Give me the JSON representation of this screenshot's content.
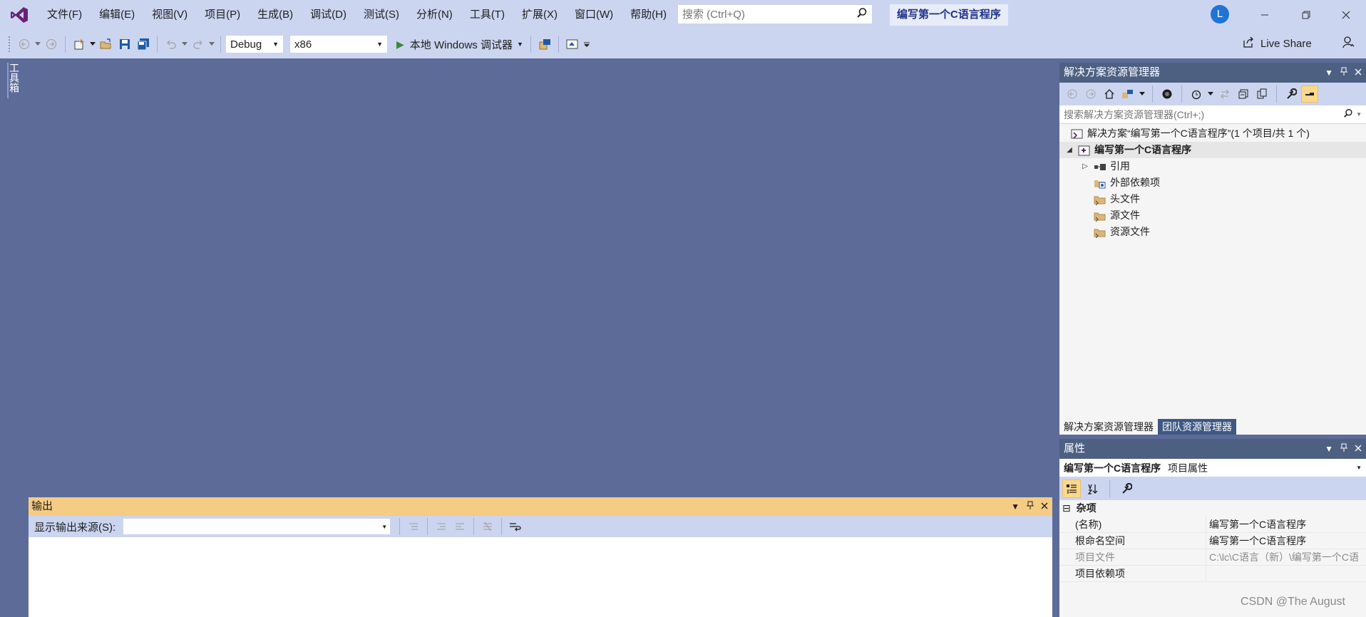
{
  "app": {
    "solution_title": "编写第一个C语言程序",
    "user_initial": "L"
  },
  "menu": {
    "items": [
      "文件(F)",
      "编辑(E)",
      "视图(V)",
      "项目(P)",
      "生成(B)",
      "调试(D)",
      "测试(S)",
      "分析(N)",
      "工具(T)",
      "扩展(X)",
      "窗口(W)",
      "帮助(H)"
    ],
    "search_placeholder": "搜索 (Ctrl+Q)"
  },
  "toolbar": {
    "configuration": "Debug",
    "platform": "x86",
    "run_label": "本地 Windows 调试器",
    "live_share": "Live Share"
  },
  "toolbox": {
    "label": "工具箱"
  },
  "solution_explorer": {
    "title": "解决方案资源管理器",
    "search_placeholder": "搜索解决方案资源管理器(Ctrl+;)",
    "solution_label": "解决方案“编写第一个C语言程序”(1 个项目/共 1 个)",
    "project_label": "编写第一个C语言程序",
    "nodes": [
      "引用",
      "外部依赖项",
      "头文件",
      "源文件",
      "资源文件"
    ],
    "tabs": [
      "解决方案资源管理器",
      "团队资源管理器"
    ]
  },
  "properties": {
    "title": "属性",
    "object_name": "编写第一个C语言程序",
    "object_type": "项目属性",
    "category": "杂项",
    "rows": [
      {
        "name": "(名称)",
        "value": "编写第一个C语言程序"
      },
      {
        "name": "根命名空间",
        "value": "编写第一个C语言程序"
      },
      {
        "name": "项目文件",
        "value": "C:\\lc\\C语言（新）\\编写第一个C语"
      },
      {
        "name": "项目依赖项",
        "value": ""
      }
    ]
  },
  "output": {
    "title": "输出",
    "source_label": "显示输出来源(S):",
    "source_value": ""
  },
  "watermark": "CSDN @The    August",
  "colors": {
    "chrome": "#ccd5f0",
    "workspace": "#5d6b99",
    "panel_title": "#4d6082",
    "output_title": "#f5cc84",
    "accent": "#68217a"
  }
}
